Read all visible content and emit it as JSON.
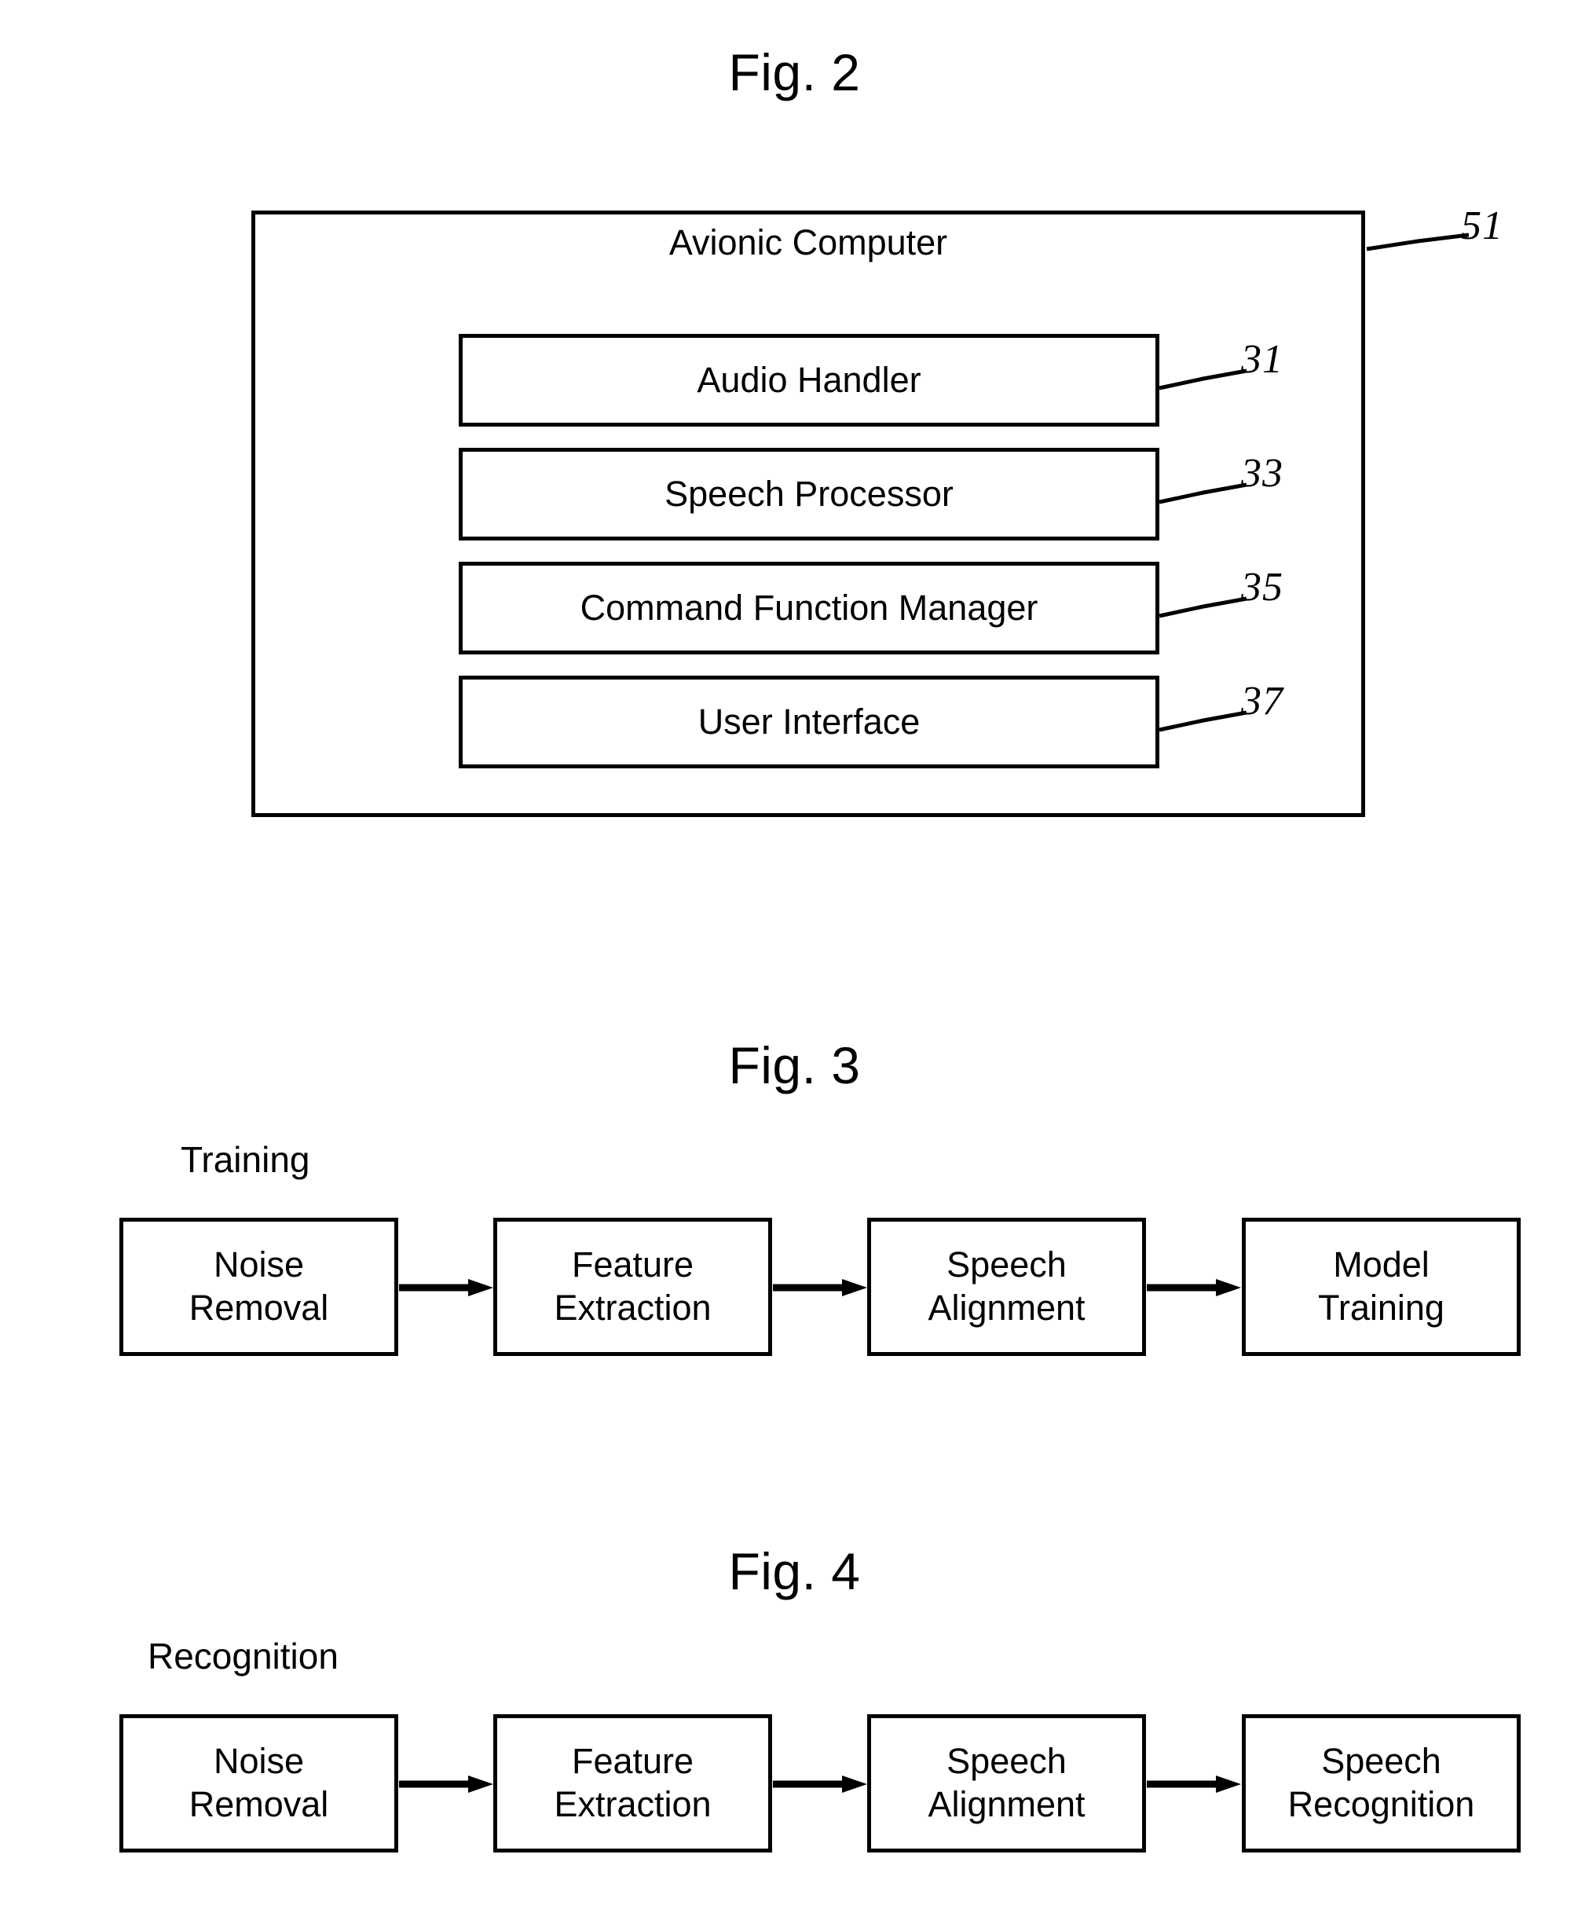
{
  "figures": [
    {
      "title": "Fig. 2",
      "type": "block-diagram",
      "container": {
        "label": "Avionic Computer",
        "ref": "51"
      },
      "blocks": [
        {
          "label": "Audio Handler",
          "ref": "31"
        },
        {
          "label": "Speech Processor",
          "ref": "33"
        },
        {
          "label": "Command Function Manager",
          "ref": "35"
        },
        {
          "label": "User Interface",
          "ref": "37"
        }
      ]
    },
    {
      "title": "Fig. 3",
      "type": "flow-diagram",
      "phase_label": "Training",
      "steps": [
        {
          "label": "Noise\nRemoval"
        },
        {
          "label": "Feature\nExtraction"
        },
        {
          "label": "Speech\nAlignment"
        },
        {
          "label": "Model\nTraining"
        }
      ]
    },
    {
      "title": "Fig. 4",
      "type": "flow-diagram",
      "phase_label": "Recognition",
      "steps": [
        {
          "label": "Noise\nRemoval"
        },
        {
          "label": "Feature\nExtraction"
        },
        {
          "label": "Speech\nAlignment"
        },
        {
          "label": "Speech\nRecognition"
        }
      ]
    }
  ],
  "colors": {
    "ink": "#000000",
    "paper": "#ffffff"
  }
}
